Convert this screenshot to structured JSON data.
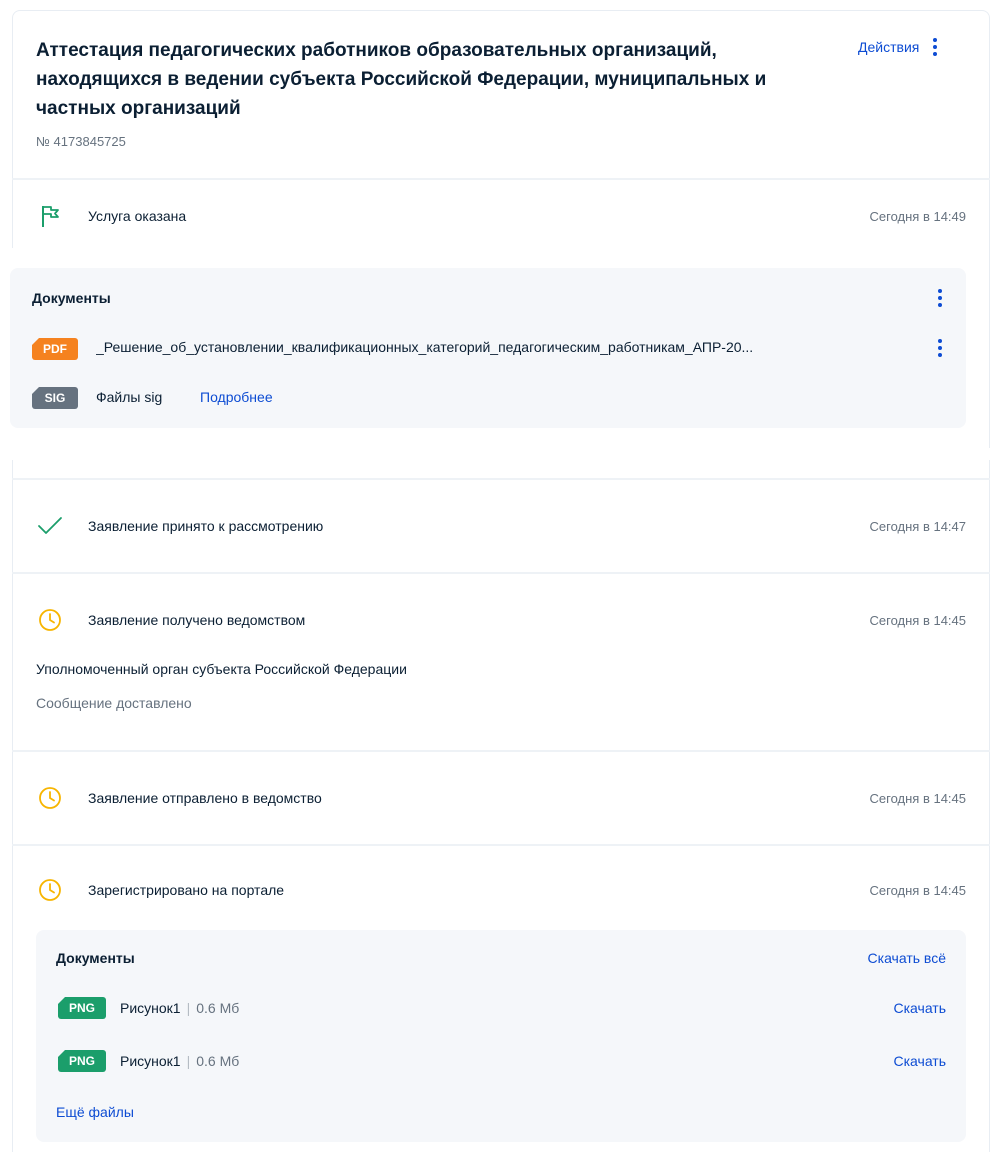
{
  "header": {
    "title": "Аттестация педагогических работников образовательных организаций, находящихся в ведении субъекта Российской Федерации, муниципальных и частных организаций",
    "order_number": "№ 4173845725",
    "actions_label": "Действия"
  },
  "status_result": {
    "text": "Услуга оказана",
    "time": "Сегодня в 14:49",
    "icon": "flag-icon",
    "icon_color": "#1b9e6b"
  },
  "result_documents": {
    "title": "Документы",
    "files": [
      {
        "type": "PDF",
        "name": "_Решение_об_установлении_квалификационных_категорий_педагогическим_работникам_АПР-20..."
      }
    ],
    "sig": {
      "type": "SIG",
      "name": "Файлы sig",
      "more_link": "Подробнее"
    }
  },
  "timeline": [
    {
      "text": "Заявление принято к рассмотрению",
      "time": "Сегодня в 14:47",
      "icon": "check-icon"
    },
    {
      "text": "Заявление получено ведомством",
      "time": "Сегодня в 14:45",
      "icon": "clock-icon",
      "details": [
        "Уполномоченный орган субъекта Российской Федерации",
        "Сообщение доставлено"
      ]
    },
    {
      "text": "Заявление отправлено в ведомство",
      "time": "Сегодня в 14:45",
      "icon": "clock-icon"
    },
    {
      "text": "Зарегистрировано на портале",
      "time": "Сегодня в 14:45",
      "icon": "clock-icon"
    }
  ],
  "submitted_documents": {
    "title": "Документы",
    "download_all": "Скачать всё",
    "files": [
      {
        "type": "PNG",
        "name": "Рисунок1",
        "size": "0.6 Мб",
        "download": "Скачать"
      },
      {
        "type": "PNG",
        "name": "Рисунок1",
        "size": "0.6 Мб",
        "download": "Скачать"
      }
    ],
    "more_files": "Ещё файлы"
  },
  "colors": {
    "link": "#0d4cd3",
    "success": "#1b9e6b",
    "pending": "#f7b500",
    "pdf": "#f5821f",
    "sig": "#66727f",
    "png": "#1b9e6b"
  }
}
